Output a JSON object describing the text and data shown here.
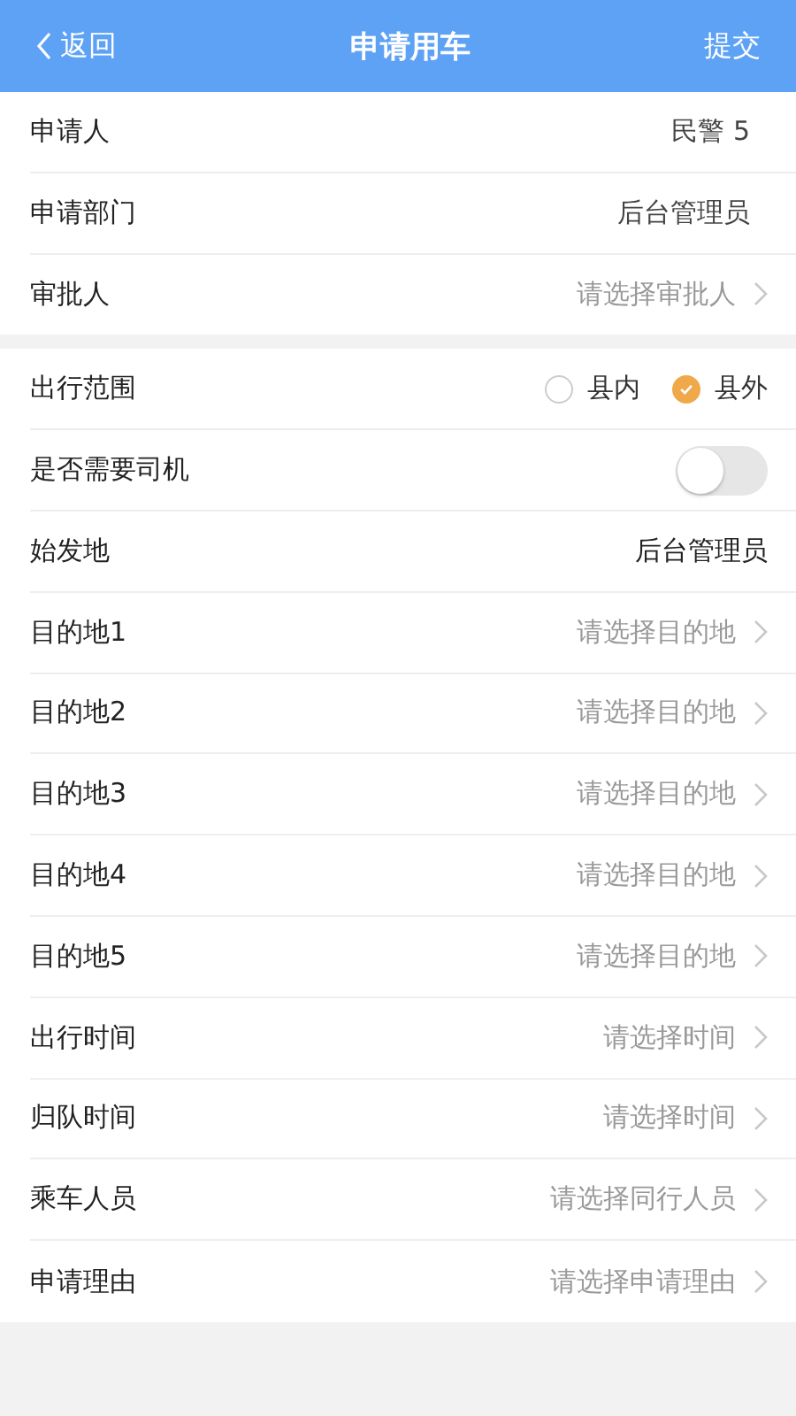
{
  "nav": {
    "back": "返回",
    "title": "申请用车",
    "action": "提交"
  },
  "sections": [
    {
      "rows": [
        {
          "kind": "value",
          "label": "申请人",
          "value": "民警 5"
        },
        {
          "kind": "value",
          "label": "申请部门",
          "value": "后台管理员"
        },
        {
          "kind": "picker",
          "label": "审批人",
          "placeholder": "请选择审批人"
        }
      ]
    },
    {
      "rows": [
        {
          "kind": "radio",
          "label": "出行范围",
          "options": [
            {
              "label": "县内",
              "selected": false
            },
            {
              "label": "县外",
              "selected": true
            }
          ]
        },
        {
          "kind": "switch",
          "label": "是否需要司机",
          "on": false
        },
        {
          "kind": "value",
          "label": "始发地",
          "value": "后台管理员"
        },
        {
          "kind": "picker",
          "label": "目的地1",
          "placeholder": "请选择目的地"
        },
        {
          "kind": "picker",
          "label": "目的地2",
          "placeholder": "请选择目的地"
        },
        {
          "kind": "picker",
          "label": "目的地3",
          "placeholder": "请选择目的地"
        },
        {
          "kind": "picker",
          "label": "目的地4",
          "placeholder": "请选择目的地"
        },
        {
          "kind": "picker",
          "label": "目的地5",
          "placeholder": "请选择目的地"
        },
        {
          "kind": "picker",
          "label": "出行时间",
          "placeholder": "请选择时间"
        },
        {
          "kind": "picker",
          "label": "归队时间",
          "placeholder": "请选择时间"
        },
        {
          "kind": "picker",
          "label": "乘车人员",
          "placeholder": "请选择同行人员"
        },
        {
          "kind": "picker",
          "label": "申请理由",
          "placeholder": "请选择申请理由"
        }
      ]
    }
  ]
}
